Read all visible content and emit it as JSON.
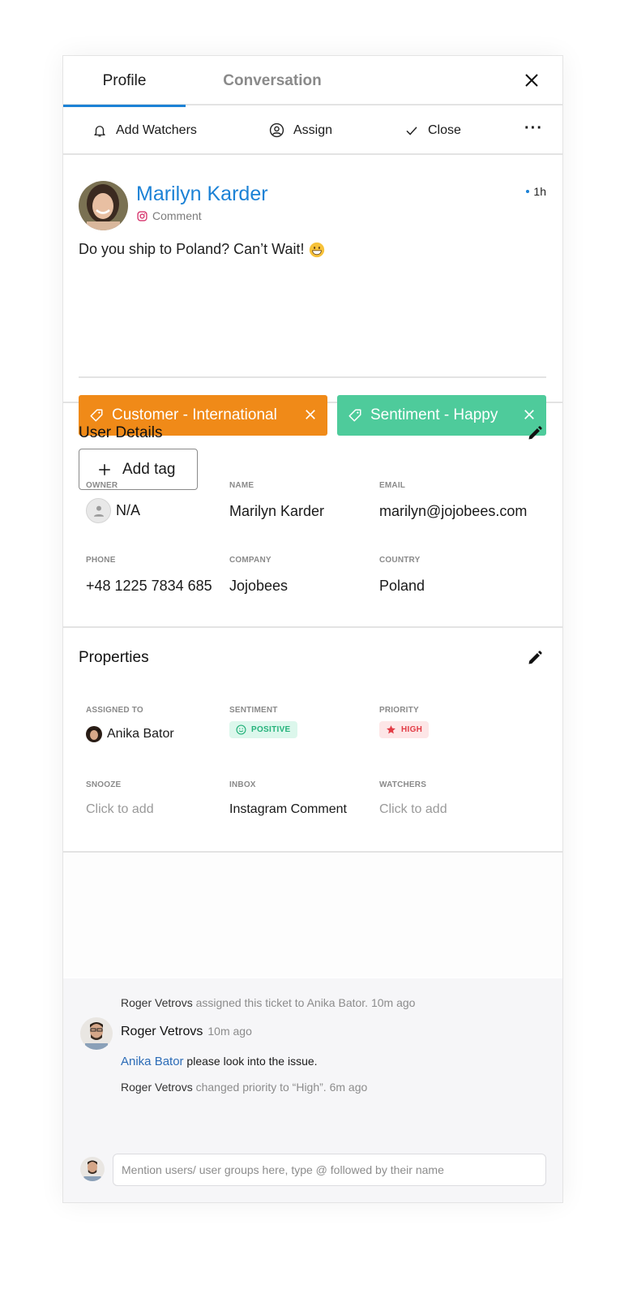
{
  "tabs": [
    {
      "label": "Profile",
      "active": true
    },
    {
      "label": "Conversation",
      "active": false
    }
  ],
  "toolbar": {
    "add_watchers": "Add Watchers",
    "assign": "Assign",
    "close": "Close",
    "more": "···"
  },
  "post": {
    "author": "Marilyn Karder",
    "source": "Comment",
    "source_icon": "instagram-icon",
    "time": "1h",
    "message": "Do you ship to Poland? Can’t Wait!",
    "emoji": "grinning-face"
  },
  "tags": [
    {
      "label": "Customer - International",
      "color": "#f08a18"
    },
    {
      "label": "Sentiment - Happy",
      "color": "#4ecb9b"
    }
  ],
  "add_tag_label": "Add tag",
  "user_details": {
    "title": "User Details",
    "fields": {
      "owner": {
        "label": "OWNER",
        "value": "N/A"
      },
      "name": {
        "label": "NAME",
        "value": "Marilyn Karder"
      },
      "email": {
        "label": "EMAIL",
        "value": "marilyn@jojobees.com"
      },
      "phone": {
        "label": "PHONE",
        "value": "+48 1225 7834 685"
      },
      "company": {
        "label": "COMPANY",
        "value": "Jojobees"
      },
      "country": {
        "label": "COUNTRY",
        "value": "Poland"
      }
    }
  },
  "properties": {
    "title": "Properties",
    "fields": {
      "assigned_to": {
        "label": "ASSIGNED TO",
        "value": "Anika Bator"
      },
      "sentiment": {
        "label": "SENTIMENT",
        "value": "POSITIVE",
        "color": "#25b27b"
      },
      "priority": {
        "label": "PRIORITY",
        "value": "HIGH",
        "color": "#e23b45"
      },
      "snooze": {
        "label": "SNOOZE",
        "value": "Click to add"
      },
      "inbox": {
        "label": "INBOX",
        "value": "Instagram Comment"
      },
      "watchers": {
        "label": "WATCHERS",
        "value": "Click to add"
      }
    }
  },
  "activity": {
    "events": [
      {
        "actor": "Roger Vetrovs",
        "text": " assigned this ticket to Anika Bator.  10m ago"
      },
      {
        "actor": "Roger Vetrovs",
        "text": " changed priority to “High”. 6m ago"
      }
    ],
    "comment": {
      "author": "Roger Vetrovs",
      "time": "10m ago",
      "mention": "Anika Bator",
      "text": " please look into the issue."
    },
    "composer_placeholder": "Mention users/ user groups here, type @ followed by their name"
  },
  "colors": {
    "accent": "#1c82d6",
    "border": "#e3e3e3"
  }
}
